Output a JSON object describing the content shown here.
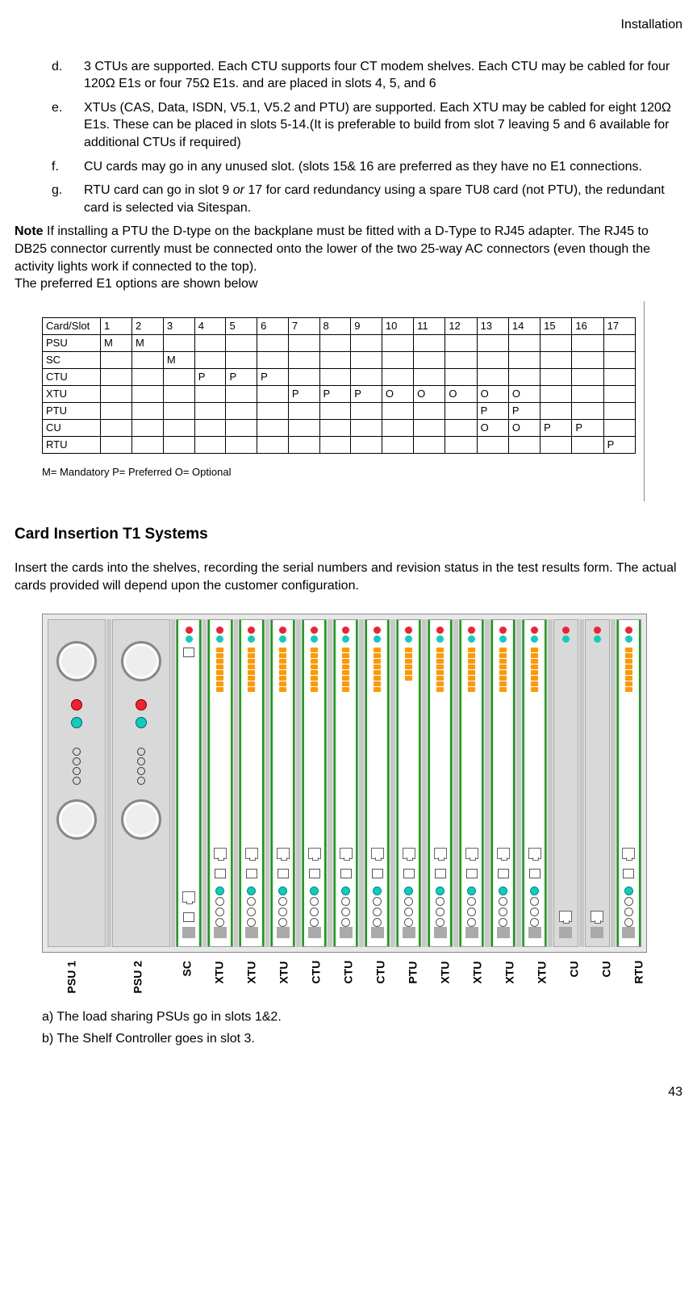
{
  "header": {
    "section": "Installation"
  },
  "page_number": "43",
  "list": {
    "d": {
      "marker": "d.",
      "text": "3 CTUs are supported. Each CTU supports four CT modem shelves. Each CTU may be cabled for four 120Ω E1s or four 75Ω E1s. and are placed in slots 4, 5, and 6"
    },
    "e": {
      "marker": "e.",
      "text": "XTUs (CAS, Data, ISDN, V5.1, V5.2 and PTU) are supported. Each XTU may be cabled for eight 120Ω E1s. These can be placed in slots 5-14.(It is preferable to build from slot 7 leaving 5 and 6 available for additional CTUs if required)"
    },
    "f": {
      "marker": "f.",
      "text": "CU cards may go in any unused slot. (slots 15& 16 are preferred as they have no E1 connections."
    },
    "g": {
      "marker": "g.",
      "text_pre": "RTU card can go in slot 9 ",
      "text_ital": "or",
      "text_post": " 17 for card redundancy using a spare TU8 card (not PTU), the redundant card is selected via Sitespan."
    }
  },
  "note": {
    "label": "Note",
    "body": " If installing a PTU the D-type on the backplane must be fitted with a D-Type to RJ45 adapter. The RJ45 to DB25 connector currently must be connected onto the lower of the two 25-way AC connectors (even though the activity lights work if connected to the top).",
    "line2": "The preferred E1 options are shown below"
  },
  "table": {
    "header": [
      "Card/Slot",
      "1",
      "2",
      "3",
      "4",
      "5",
      "6",
      "7",
      "8",
      "9",
      "10",
      "11",
      "12",
      "13",
      "14",
      "15",
      "16",
      "17"
    ],
    "rows": [
      {
        "name": "PSU",
        "cells": [
          "M",
          "M",
          "",
          "",
          "",
          "",
          "",
          "",
          "",
          "",
          "",
          "",
          "",
          "",
          "",
          "",
          ""
        ]
      },
      {
        "name": "SC",
        "cells": [
          "",
          "",
          "M",
          "",
          "",
          "",
          "",
          "",
          "",
          "",
          "",
          "",
          "",
          "",
          "",
          "",
          ""
        ]
      },
      {
        "name": "CTU",
        "cells": [
          "",
          "",
          "",
          "P",
          "P",
          "P",
          "",
          "",
          "",
          "",
          "",
          "",
          "",
          "",
          "",
          "",
          ""
        ]
      },
      {
        "name": "XTU",
        "cells": [
          "",
          "",
          "",
          "",
          "",
          "",
          "P",
          "P",
          "P",
          "O",
          "O",
          "O",
          "O",
          "O",
          "",
          "",
          ""
        ]
      },
      {
        "name": "PTU",
        "cells": [
          "",
          "",
          "",
          "",
          "",
          "",
          "",
          "",
          "",
          "",
          "",
          "",
          "P",
          "P",
          "",
          "",
          ""
        ]
      },
      {
        "name": "CU",
        "cells": [
          "",
          "",
          "",
          "",
          "",
          "",
          "",
          "",
          "",
          "",
          "",
          "",
          "O",
          "O",
          "P",
          "P",
          ""
        ]
      },
      {
        "name": "RTU",
        "cells": [
          "",
          "",
          "",
          "",
          "",
          "",
          "",
          "",
          "",
          "",
          "",
          "",
          "",
          "",
          "",
          "",
          "P"
        ]
      }
    ],
    "legend": "M= Mandatory P= Preferred O= Optional"
  },
  "heading2": "Card Insertion T1 Systems",
  "intro": "Insert the cards into the shelves, recording the serial numbers and revision status in the test results form. The actual cards provided will depend upon the customer configuration.",
  "shelf_labels": [
    "PSU 1",
    "PSU 2",
    "SC",
    "XTU",
    "XTU",
    "XTU",
    "CTU",
    "CTU",
    "CTU",
    "PTU",
    "XTU",
    "XTU",
    "XTU",
    "XTU",
    "CU",
    "CU",
    "RTU"
  ],
  "sub_a": "a) The load sharing PSUs go in slots 1&2.",
  "sub_b": "b) The Shelf Controller goes in slot 3.",
  "chart_data": {
    "type": "table",
    "title": "Preferred E1 slot options",
    "columns": [
      "Card/Slot",
      "1",
      "2",
      "3",
      "4",
      "5",
      "6",
      "7",
      "8",
      "9",
      "10",
      "11",
      "12",
      "13",
      "14",
      "15",
      "16",
      "17"
    ],
    "rows": [
      [
        "PSU",
        "M",
        "M",
        "",
        "",
        "",
        "",
        "",
        "",
        "",
        "",
        "",
        "",
        "",
        "",
        "",
        "",
        ""
      ],
      [
        "SC",
        "",
        "",
        "M",
        "",
        "",
        "",
        "",
        "",
        "",
        "",
        "",
        "",
        "",
        "",
        "",
        "",
        ""
      ],
      [
        "CTU",
        "",
        "",
        "",
        "P",
        "P",
        "P",
        "",
        "",
        "",
        "",
        "",
        "",
        "",
        "",
        "",
        "",
        ""
      ],
      [
        "XTU",
        "",
        "",
        "",
        "",
        "",
        "",
        "P",
        "P",
        "P",
        "O",
        "O",
        "O",
        "O",
        "O",
        "",
        "",
        ""
      ],
      [
        "PTU",
        "",
        "",
        "",
        "",
        "",
        "",
        "",
        "",
        "",
        "",
        "",
        "",
        "P",
        "P",
        "",
        "",
        ""
      ],
      [
        "CU",
        "",
        "",
        "",
        "",
        "",
        "",
        "",
        "",
        "",
        "",
        "",
        "",
        "O",
        "O",
        "P",
        "P",
        ""
      ],
      [
        "RTU",
        "",
        "",
        "",
        "",
        "",
        "",
        "",
        "",
        "",
        "",
        "",
        "",
        "",
        "",
        "",
        "",
        "P"
      ]
    ],
    "legend": {
      "M": "Mandatory",
      "P": "Preferred",
      "O": "Optional"
    }
  }
}
